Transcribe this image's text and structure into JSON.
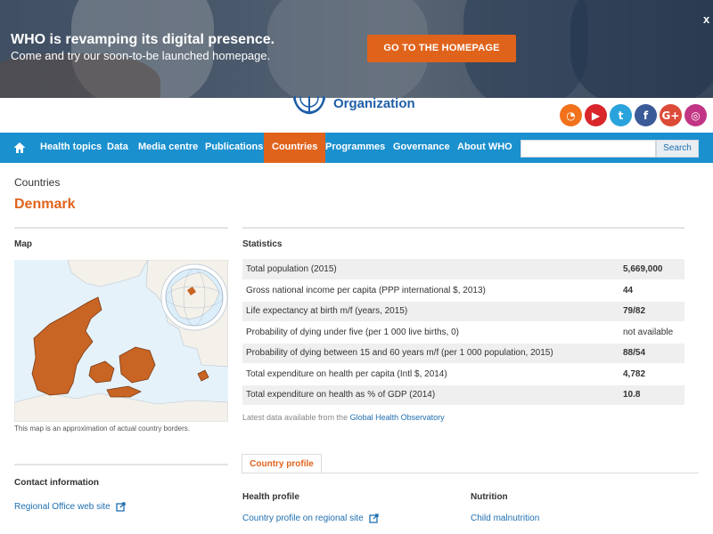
{
  "banner": {
    "title": "WHO is revamping its digital presence.",
    "subtitle": "Come and try our soon-to-be launched homepage.",
    "button_label": "GO TO THE HOMEPAGE",
    "close_label": "x"
  },
  "header": {
    "org_text": "Organization",
    "social": [
      {
        "name": "rss-icon",
        "glyph": "◔",
        "color": "#f2721c"
      },
      {
        "name": "youtube-icon",
        "glyph": "▶",
        "color": "#d8262a"
      },
      {
        "name": "twitter-icon",
        "glyph": "t",
        "color": "#2aa3dc"
      },
      {
        "name": "facebook-icon",
        "glyph": "f",
        "color": "#3b5a98"
      },
      {
        "name": "google-plus-icon",
        "glyph": "G+",
        "color": "#dc4a38"
      },
      {
        "name": "instagram-icon",
        "glyph": "◎",
        "color": "#c13584"
      }
    ]
  },
  "nav": {
    "items": [
      "Health topics",
      "Data",
      "Media centre",
      "Publications",
      "Countries",
      "Programmes",
      "Governance",
      "About WHO"
    ],
    "active": "Countries",
    "search_button": "Search",
    "search_placeholder": ""
  },
  "page": {
    "breadcrumb": "Countries",
    "country": "Denmark"
  },
  "map_section": {
    "heading": "Map",
    "caption": "This map is an approximation of actual country borders."
  },
  "statistics": {
    "heading": "Statistics",
    "rows": [
      {
        "label": "Total population (2015)",
        "value": "5,669,000"
      },
      {
        "label": "Gross national income per capita (PPP international $, 2013)",
        "value": "44"
      },
      {
        "label": "Life expectancy at birth m/f (years, 2015)",
        "value": "79/82"
      },
      {
        "label": "Probability of dying under five (per 1 000 live births, 0)",
        "value": "not available"
      },
      {
        "label": "Probability of dying between 15 and 60 years m/f (per 1 000 population, 2015)",
        "value": "88/54"
      },
      {
        "label": "Total expenditure on health per capita (Intl $, 2014)",
        "value": "4,782"
      },
      {
        "label": "Total expenditure on health as % of GDP (2014)",
        "value": "10.8"
      }
    ],
    "note_prefix": "Latest data available from the ",
    "note_link": "Global Health Observatory"
  },
  "contact": {
    "heading": "Contact information",
    "regional_link": "Regional Office web site"
  },
  "profile": {
    "tab_label": "Country profile",
    "health_heading": "Health profile",
    "health_link": "Country profile on regional site",
    "nutrition_heading": "Nutrition",
    "nutrition_link": "Child malnutrition"
  },
  "colors": {
    "accent": "#e0631c",
    "nav": "#1a90cf",
    "link": "#1f6fb0"
  }
}
